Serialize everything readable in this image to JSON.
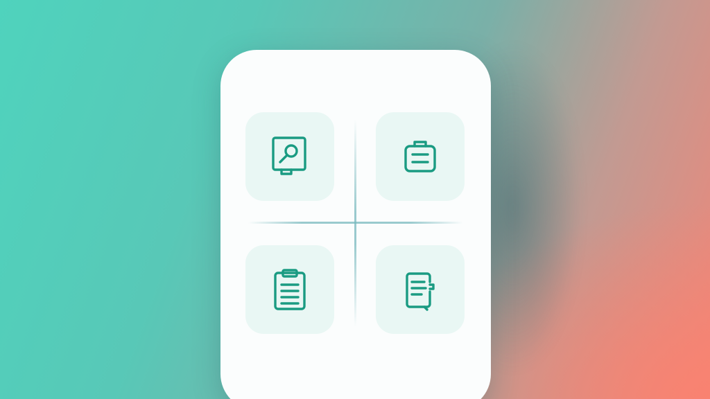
{
  "colors": {
    "accent": "#1a9b82",
    "tile_background": "#e9f7f4",
    "card_background": "#fbfdfd",
    "gradient_left": "#4fd3bd",
    "gradient_right": "#f08678"
  },
  "grid": {
    "tiles": [
      {
        "icon": "search-document-icon"
      },
      {
        "icon": "briefcase-icon"
      },
      {
        "icon": "clipboard-icon"
      },
      {
        "icon": "notepad-icon"
      }
    ]
  }
}
